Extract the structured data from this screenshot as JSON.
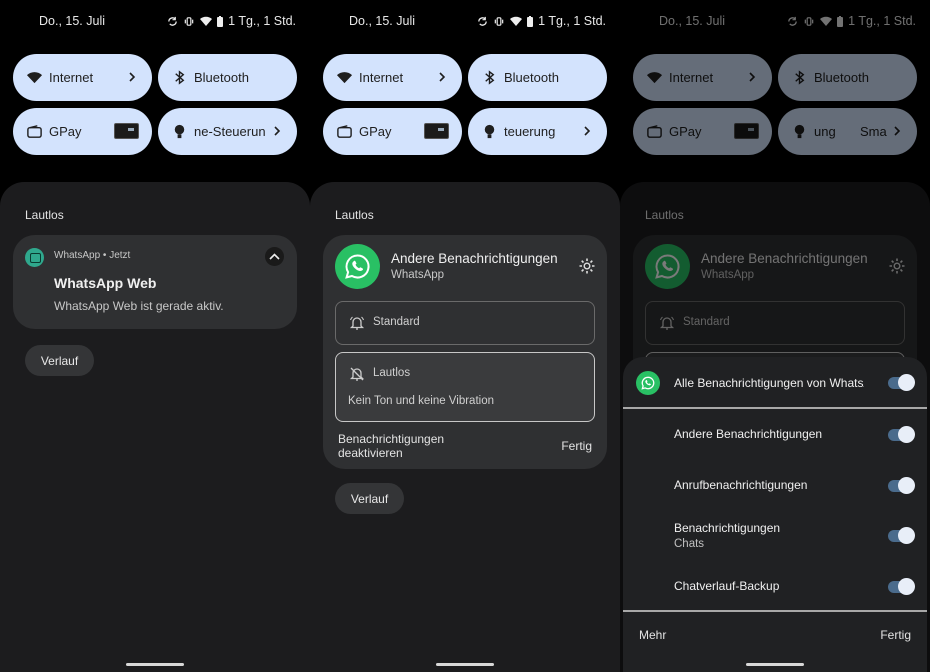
{
  "status": {
    "date": "Do., 15. Juli",
    "battery_text": "1 Tg., 1 Std."
  },
  "quick_tiles": {
    "internet": "Internet",
    "bluetooth": "Bluetooth",
    "gpay": "GPay",
    "home_p1": "ne-Steuerun",
    "home_p2": "teuerung",
    "home_p3a": "ung",
    "home_p3b": "Sma"
  },
  "panel1": {
    "section": "Lautlos",
    "notification": {
      "app": "WhatsApp",
      "time": "Jetzt",
      "title": "WhatsApp Web",
      "body": "WhatsApp Web ist gerade aktiv."
    },
    "history": "Verlauf"
  },
  "panel2": {
    "section": "Lautlos",
    "channel_title": "Andere Benachrichtigungen",
    "channel_app": "WhatsApp",
    "standard_label": "Standard",
    "silent_label": "Lautlos",
    "silent_desc": "Kein Ton und keine Vibration",
    "deactivate_line1": "Benachrichtigungen",
    "deactivate_line2": "deaktivieren",
    "done": "Fertig",
    "history": "Verlauf"
  },
  "panel3": {
    "section": "Lautlos",
    "channel_title": "Andere Benachrichtigungen",
    "channel_app": "WhatsApp",
    "standard_label": "Standard",
    "popup": {
      "all_label": "Alle Benachrichtigungen von WhatsApp",
      "items": [
        {
          "label": "Andere Benachrichtigungen",
          "sub": ""
        },
        {
          "label": "Anrufbenachrichtigungen",
          "sub": ""
        },
        {
          "label": "Benachrichtigungen",
          "sub": "Chats"
        },
        {
          "label": "Chatverlauf-Backup",
          "sub": ""
        }
      ],
      "more": "Mehr",
      "done": "Fertig"
    }
  },
  "colors": {
    "tile_bg": "#d3e3fd",
    "sheet_bg": "#1c1c1e",
    "whatsapp_green": "#29c064"
  }
}
